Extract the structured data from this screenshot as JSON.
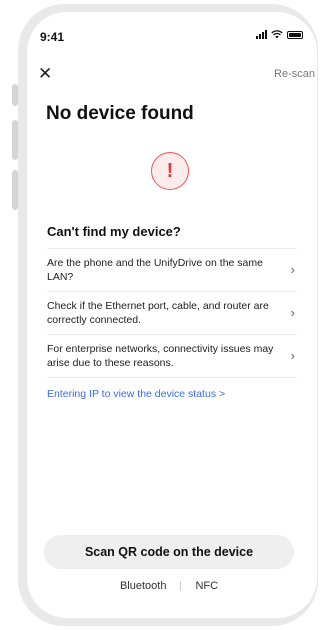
{
  "status_bar": {
    "time": "9:41"
  },
  "header": {
    "close_symbol": "✕",
    "rescan_label": "Re-scan"
  },
  "page": {
    "title": "No device found",
    "alert_symbol": "!"
  },
  "help": {
    "title": "Can't find my device?",
    "items": [
      {
        "text": "Are the phone and the UnifyDrive on the same LAN?"
      },
      {
        "text": "Check if the Ethernet port, cable, and router are correctly connected."
      },
      {
        "text": "For enterprise networks, connectivity issues may arise due to these reasons."
      }
    ],
    "ip_link": "Entering IP to view the device status >"
  },
  "actions": {
    "scan_qr": "Scan QR code on the device",
    "bluetooth": "Bluetooth",
    "nfc": "NFC"
  },
  "icons": {
    "chevron": "›"
  },
  "colors": {
    "accent": "#3a6ee8",
    "alert": "#e53935"
  }
}
